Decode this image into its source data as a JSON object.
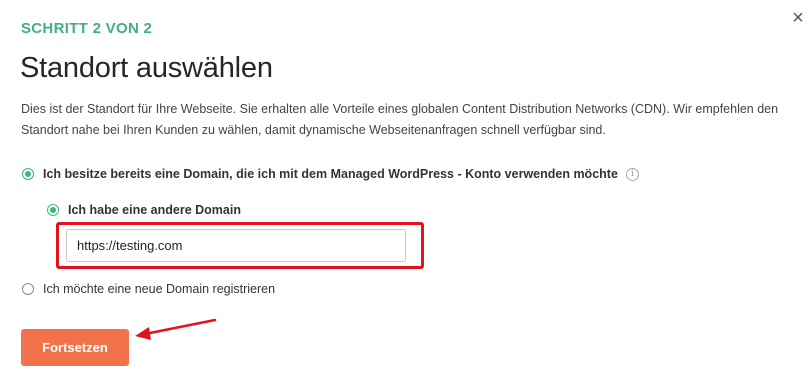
{
  "header": {
    "step_label": "SCHRITT 2 VON 2",
    "title": "Standort auswählen",
    "close_icon": "close-icon"
  },
  "description": "Dies ist der Standort für Ihre Webseite. Sie erhalten alle Vorteile eines globalen Content Distribution Networks (CDN). Wir empfehlen den Standort nahe bei Ihren Kunden zu wählen, damit dynamische Webseitenanfragen schnell verfügbar sind.",
  "options": {
    "existing_domain": {
      "label": "Ich besitze bereits eine Domain, die ich mit dem Managed WordPress - Konto verwenden möchte",
      "selected": true,
      "info_icon": "info-icon"
    },
    "other_domain": {
      "label": "Ich habe eine andere Domain",
      "selected": true
    },
    "domain_input": {
      "value": "https://testing.com"
    },
    "new_domain": {
      "label": "Ich möchte eine neue Domain registrieren",
      "selected": false
    }
  },
  "actions": {
    "continue_label": "Fortsetzen"
  },
  "colors": {
    "accent_green": "#3fb27f",
    "button_orange": "#f2734a",
    "highlight_red": "#e0141e"
  }
}
